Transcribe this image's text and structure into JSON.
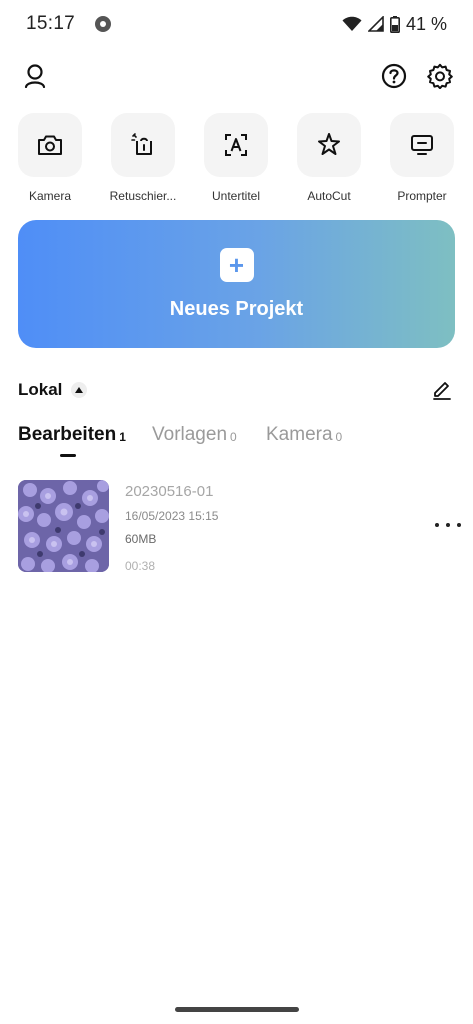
{
  "status_bar": {
    "time": "15:17",
    "battery": "41 %",
    "icons": [
      "chrome-icon",
      "wifi-icon",
      "signal-icon",
      "battery-icon"
    ]
  },
  "top_bar": {
    "icons": [
      "profile-icon",
      "help-icon",
      "settings-icon"
    ]
  },
  "tools": [
    {
      "label": "Kamera",
      "icon": "camera-icon"
    },
    {
      "label": "Retuschier...",
      "icon": "retouch-icon"
    },
    {
      "label": "Untertitel",
      "icon": "subtitle-icon"
    },
    {
      "label": "AutoCut",
      "icon": "autocut-icon"
    },
    {
      "label": "Prompter",
      "icon": "prompter-icon"
    }
  ],
  "new_project": {
    "label": "Neues Projekt",
    "plus": "+",
    "gradient": [
      "#4f8ef7",
      "#7ebfc2"
    ]
  },
  "section": {
    "title": "Lokal"
  },
  "tabs": [
    {
      "label": "Bearbeiten",
      "count": "1",
      "active": true
    },
    {
      "label": "Vorlagen",
      "count": "0",
      "active": false
    },
    {
      "label": "Kamera",
      "count": "0",
      "active": false
    }
  ],
  "projects": [
    {
      "name": "20230516-01",
      "date": "16/05/2023 15:15",
      "size": "60MB",
      "duration": "00:38"
    }
  ],
  "colors": {
    "accent": "#4f8ef7",
    "thumb_purple": "#7a6fb8"
  }
}
